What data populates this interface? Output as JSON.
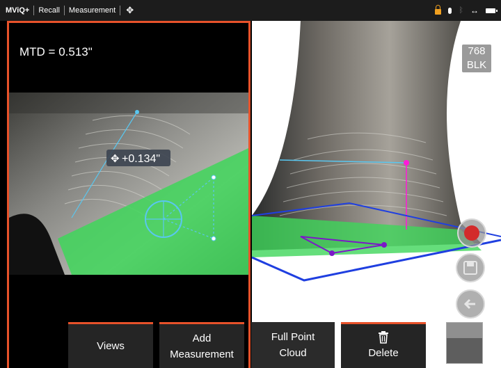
{
  "topbar": {
    "app": "MViQ+",
    "crumb1": "Recall",
    "crumb2": "Measurement",
    "move_icon": "move-arrows-icon"
  },
  "measurement": {
    "mtd_label": "MTD = 0.513\"",
    "depth_label": "+0.134\""
  },
  "view3d": {
    "resolution_badge_top": "768",
    "resolution_badge_bottom": "BLK"
  },
  "toolbar": {
    "views_label": "Views",
    "add_line1": "Add",
    "add_line2": "Measurement",
    "fpc_line1": "Full Point",
    "fpc_line2": "Cloud",
    "delete_label": "Delete"
  },
  "colors": {
    "accent": "#e8522a",
    "overlay_green": "#3fd65a",
    "cursor_blue": "#59c7f0",
    "plane_blue": "#1f3fe0",
    "marker_purple": "#7b18c8",
    "marker_magenta": "#ff1ad9"
  }
}
